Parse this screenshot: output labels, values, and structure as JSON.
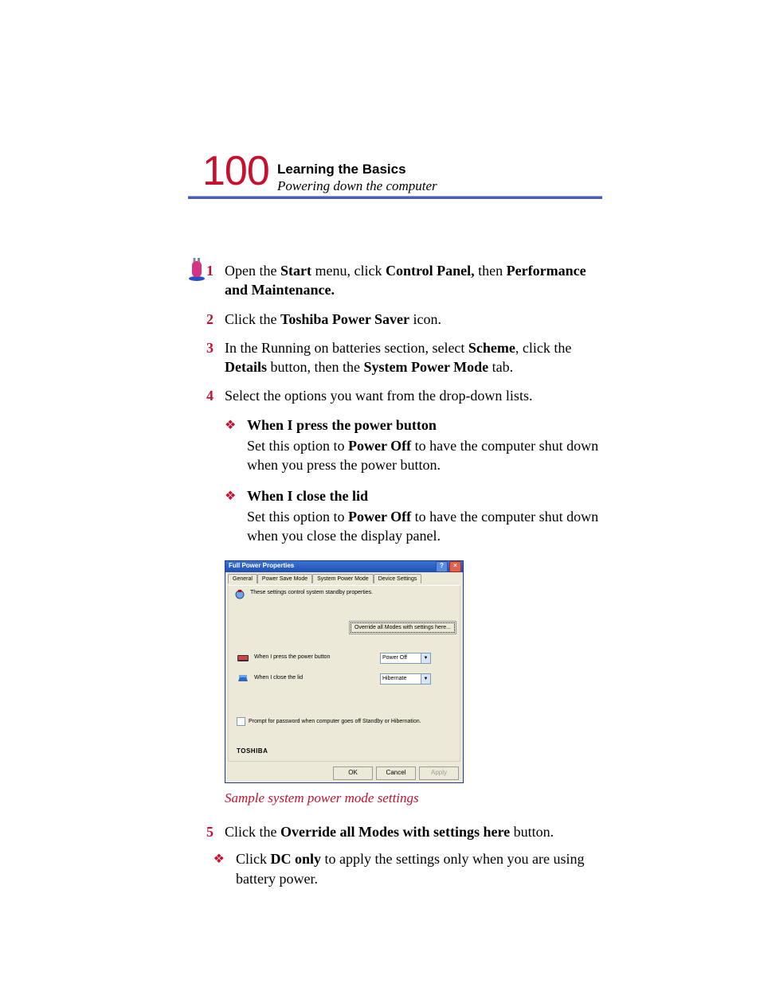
{
  "header": {
    "page_number": "100",
    "chapter": "Learning the Basics",
    "section": "Powering down the computer"
  },
  "steps": {
    "s1": {
      "num": "1",
      "pre": "Open the ",
      "b1": "Start",
      "mid1": " menu, click ",
      "b2": "Control Panel,",
      "mid2": " then ",
      "b3": "Performance and Maintenance."
    },
    "s2": {
      "num": "2",
      "pre": "Click the ",
      "b1": "Toshiba Power Saver",
      "post": " icon."
    },
    "s3": {
      "num": "3",
      "pre": "In the Running on batteries section, select ",
      "b1": "Scheme",
      "mid1": ", click the ",
      "b2": "Details",
      "mid2": " button, then the ",
      "b3": "System Power Mode",
      "post": " tab."
    },
    "s4": {
      "num": "4",
      "text": "Select the options you want from the drop-down lists."
    },
    "s5": {
      "num": "5",
      "pre": "Click the ",
      "b1": "Override all Modes with settings here",
      "post": " button."
    }
  },
  "bullets": {
    "a": {
      "title": "When I press the power button",
      "pre": "Set this option to ",
      "bold": "Power Off",
      "post": " to have the computer shut down when you press the power button."
    },
    "b": {
      "title": "When I close the lid",
      "pre": "Set this option to ",
      "bold": "Power Off",
      "post": " to have the computer shut down when you close the display panel."
    },
    "c": {
      "pre": "Click ",
      "bold": "DC only",
      "post": " to apply the settings only when you are using battery power."
    }
  },
  "dialog": {
    "title": "Full Power Properties",
    "tabs": {
      "t1": "General",
      "t2": "Power Save Mode",
      "t3": "System Power Mode",
      "t4": "Device Settings"
    },
    "description": "These settings control system standby properties.",
    "override": "Override all Modes with settings here...",
    "row1": {
      "label": "When I press the power button",
      "value": "Power Off"
    },
    "row2": {
      "label": "When I close the lid",
      "value": "Hibernate"
    },
    "checkbox": "Prompt for password when computer goes off Standby or Hibernation.",
    "brand": "TOSHIBA",
    "buttons": {
      "ok": "OK",
      "cancel": "Cancel",
      "apply": "Apply"
    }
  },
  "caption": "Sample system power mode settings"
}
